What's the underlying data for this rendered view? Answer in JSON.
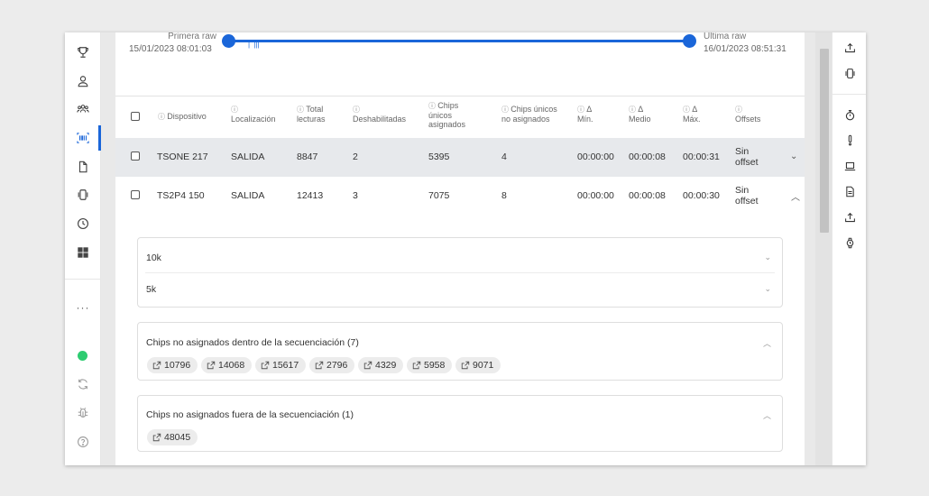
{
  "timeline": {
    "start_label": "Primera raw",
    "start_date": "15/01/2023 08:01:03",
    "end_label": "Última raw",
    "end_date": "16/01/2023 08:51:31"
  },
  "table": {
    "headers": [
      {
        "icon": "info-icon",
        "text": "Dispositivo"
      },
      {
        "icon": "info-icon",
        "text": "Localización"
      },
      {
        "icon": "info-icon",
        "text": "Total lecturas"
      },
      {
        "icon": "info-icon",
        "text": "Deshabilitadas"
      },
      {
        "icon": "info-icon",
        "text": "Chips únicos asignados"
      },
      {
        "icon": "info-icon",
        "text": "Chips únicos no asignados"
      },
      {
        "icon": "info-icon",
        "text": "Δ Mín."
      },
      {
        "icon": "info-icon",
        "text": "Δ Medio"
      },
      {
        "icon": "info-icon",
        "text": "Δ Máx."
      },
      {
        "icon": "info-icon",
        "text": "Offsets"
      }
    ],
    "rows": [
      {
        "device": "TSONE 217",
        "location": "SALIDA",
        "total": "8847",
        "disabled": "2",
        "assigned": "5395",
        "unassigned": "4",
        "min": "00:00:00",
        "avg": "00:00:08",
        "max": "00:00:31",
        "offsets": "Sin offset"
      },
      {
        "device": "TS2P4 150",
        "location": "SALIDA",
        "total": "12413",
        "disabled": "3",
        "assigned": "7075",
        "unassigned": "8",
        "min": "00:00:00",
        "avg": "00:00:08",
        "max": "00:00:30",
        "offsets": "Sin offset"
      }
    ]
  },
  "detail": {
    "distances": [
      "10k",
      "5k"
    ],
    "inside_title": "Chips no asignados dentro de la secuenciación (7)",
    "inside_chips": [
      "10796",
      "14068",
      "15617",
      "2796",
      "4329",
      "5958",
      "9071"
    ],
    "outside_title": "Chips no asignados fuera de la secuenciación (1)",
    "outside_chips": [
      "48045"
    ]
  },
  "left_nav": [
    "trophy-icon",
    "user-icon",
    "group-icon",
    "barcode-icon",
    "document-icon",
    "chip-icon",
    "clock-icon",
    "grid-icon",
    "more-icon",
    "status-dot",
    "refresh-icon",
    "bug-icon",
    "help-icon"
  ],
  "right_bar": [
    "upload-icon",
    "chip-icon",
    "stopwatch-icon",
    "alert-icon",
    "laptop-icon",
    "file-icon",
    "upload-icon",
    "watch-icon"
  ],
  "colors": {
    "accent": "#1a66d9",
    "status_ok": "#2ecc71",
    "row_highlight": "#e7e9ec"
  }
}
